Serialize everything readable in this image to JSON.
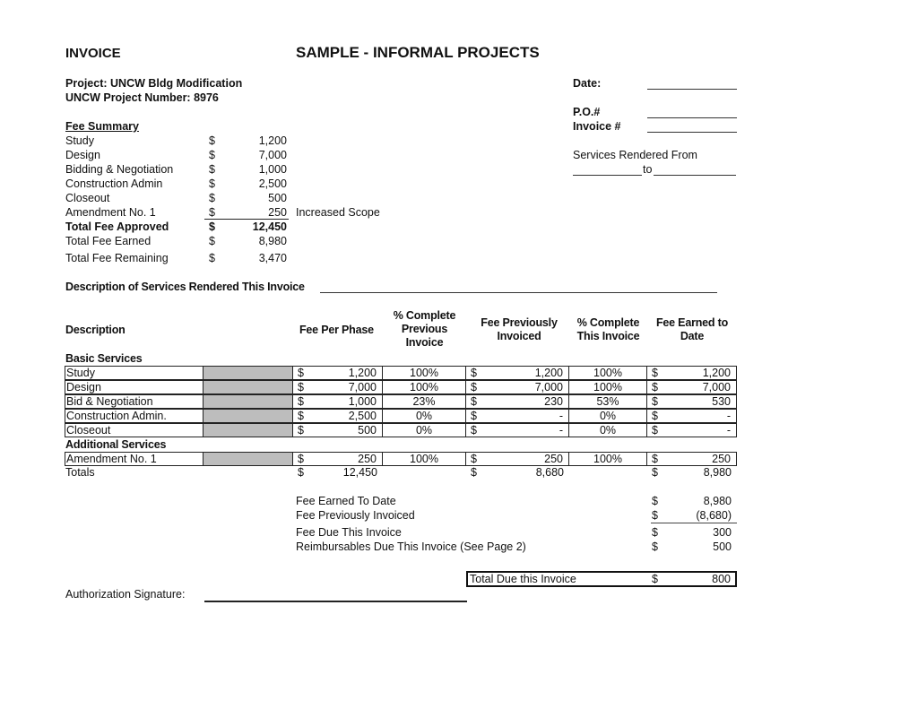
{
  "header": {
    "doc_title": "INVOICE",
    "sample_title": "SAMPLE - INFORMAL PROJECTS",
    "project_line": "Project:  UNCW Bldg Modification",
    "project_number_line": "UNCW Project Number:  8976"
  },
  "right_fields": {
    "date_label": "Date:",
    "po_label": "P.O.#",
    "invoice_label": "Invoice #",
    "services_from_label": "Services Rendered From",
    "to_label": "to"
  },
  "fee_summary": {
    "heading": "Fee Summary",
    "items": [
      {
        "label": "Study",
        "currency": "$",
        "amount": "1,200",
        "note": ""
      },
      {
        "label": "Design",
        "currency": "$",
        "amount": "7,000",
        "note": ""
      },
      {
        "label": "Bidding & Negotiation",
        "currency": "$",
        "amount": "1,000",
        "note": ""
      },
      {
        "label": "Construction Admin",
        "currency": "$",
        "amount": "2,500",
        "note": ""
      },
      {
        "label": "Closeout",
        "currency": "$",
        "amount": "500",
        "note": ""
      },
      {
        "label": "Amendment No. 1",
        "currency": "$",
        "amount": "250",
        "note": "Increased Scope"
      }
    ],
    "total_approved": {
      "label": "Total Fee Approved",
      "currency": "$",
      "amount": "12,450"
    },
    "total_earned": {
      "label": "Total Fee Earned",
      "currency": "$",
      "amount": "8,980"
    },
    "total_remaining": {
      "label": "Total Fee Remaining",
      "currency": "$",
      "amount": "3,470"
    }
  },
  "description_line": "Description of Services Rendered This Invoice",
  "table": {
    "headers": {
      "description": "Description",
      "fee_per_phase": "Fee Per Phase",
      "pct_prev_1": "% Complete",
      "pct_prev_2": "Previous",
      "pct_prev_3": "Invoice",
      "fee_prev_1": "Fee Previously",
      "fee_prev_2": "Invoiced",
      "pct_this_1": "% Complete",
      "pct_this_2": "This Invoice",
      "earned_1": "Fee Earned to",
      "earned_2": "Date"
    },
    "basic_heading": "Basic Services",
    "basic_rows": [
      {
        "desc": "Study",
        "fee": "1,200",
        "pct_prev": "100%",
        "fee_prev": "1,200",
        "pct_this": "100%",
        "earned": "1,200"
      },
      {
        "desc": "Design",
        "fee": "7,000",
        "pct_prev": "100%",
        "fee_prev": "7,000",
        "pct_this": "100%",
        "earned": "7,000"
      },
      {
        "desc": "Bid & Negotiation",
        "fee": "1,000",
        "pct_prev": "23%",
        "fee_prev": "230",
        "pct_this": "53%",
        "earned": "530"
      },
      {
        "desc": "Construction Admin.",
        "fee": "2,500",
        "pct_prev": "0%",
        "fee_prev": "-",
        "pct_this": "0%",
        "earned": "-"
      },
      {
        "desc": "Closeout",
        "fee": "500",
        "pct_prev": "0%",
        "fee_prev": "-",
        "pct_this": "0%",
        "earned": "-"
      }
    ],
    "additional_heading": "Additional Services",
    "additional_rows": [
      {
        "desc": "Amendment No. 1",
        "fee": "250",
        "pct_prev": "100%",
        "fee_prev": "250",
        "pct_this": "100%",
        "earned": "250"
      }
    ],
    "totals": {
      "label": "Totals",
      "fee": "12,450",
      "fee_prev": "8,680",
      "earned": "8,980"
    },
    "currency": "$"
  },
  "summary": {
    "rows": [
      {
        "label": "Fee Earned To Date",
        "currency": "$",
        "amount": "8,980"
      },
      {
        "label": "Fee Previously Invoiced",
        "currency": "$",
        "amount": "(8,680)"
      },
      {
        "label": "Fee Due This Invoice",
        "currency": "$",
        "amount": "300"
      },
      {
        "label": "Reimbursables Due This Invoice (See Page 2)",
        "currency": "$",
        "amount": "500"
      }
    ],
    "total_due": {
      "label": "Total Due this Invoice",
      "currency": "$",
      "amount": "800"
    }
  },
  "signature": {
    "label": "Authorization Signature:"
  }
}
